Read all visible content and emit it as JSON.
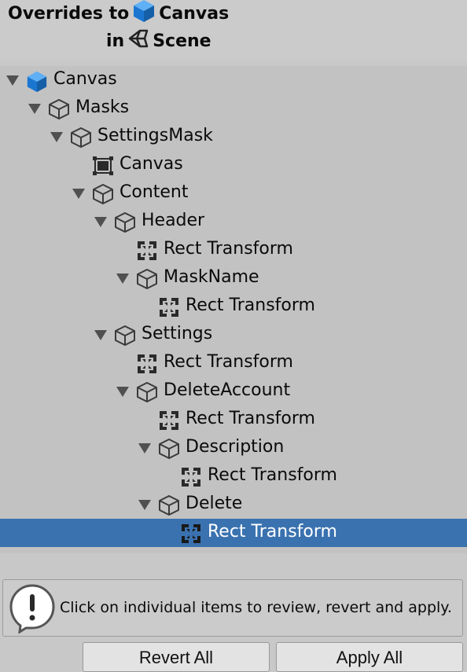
{
  "header": {
    "prefix": "Overrides to",
    "target": "Canvas",
    "in": "in",
    "scene": "Scene"
  },
  "tree": {
    "items": [
      {
        "label": "Canvas",
        "icon": "prefab-cube-blue-icon",
        "expanded": true
      },
      {
        "label": "Masks",
        "icon": "gameobject-cube-icon",
        "expanded": true
      },
      {
        "label": "SettingsMask",
        "icon": "gameobject-cube-icon",
        "expanded": true
      },
      {
        "label": "Canvas",
        "icon": "canvas-component-icon",
        "expanded": null
      },
      {
        "label": "Content",
        "icon": "gameobject-cube-icon",
        "expanded": true
      },
      {
        "label": "Header",
        "icon": "gameobject-cube-icon",
        "expanded": true
      },
      {
        "label": "Rect Transform",
        "icon": "rect-transform-icon",
        "expanded": null
      },
      {
        "label": "MaskName",
        "icon": "gameobject-cube-icon",
        "expanded": true
      },
      {
        "label": "Rect Transform",
        "icon": "rect-transform-icon",
        "expanded": null
      },
      {
        "label": "Settings",
        "icon": "gameobject-cube-icon",
        "expanded": true
      },
      {
        "label": "Rect Transform",
        "icon": "rect-transform-icon",
        "expanded": null
      },
      {
        "label": "DeleteAccount",
        "icon": "gameobject-cube-icon",
        "expanded": true
      },
      {
        "label": "Rect Transform",
        "icon": "rect-transform-icon",
        "expanded": null
      },
      {
        "label": "Description",
        "icon": "gameobject-cube-icon",
        "expanded": true
      },
      {
        "label": "Rect Transform",
        "icon": "rect-transform-icon",
        "expanded": null
      },
      {
        "label": "Delete",
        "icon": "gameobject-cube-icon",
        "expanded": true
      },
      {
        "label": "Rect Transform",
        "icon": "rect-transform-icon",
        "expanded": null,
        "selected": true
      }
    ]
  },
  "help": {
    "text": "Click on individual items to review, revert and apply.",
    "icon": "info-exclamation-icon"
  },
  "buttons": {
    "revert_all": "Revert All",
    "apply_all": "Apply All"
  },
  "colors": {
    "selection": "#3a72b0",
    "prefab_blue": "#1b76d1"
  }
}
